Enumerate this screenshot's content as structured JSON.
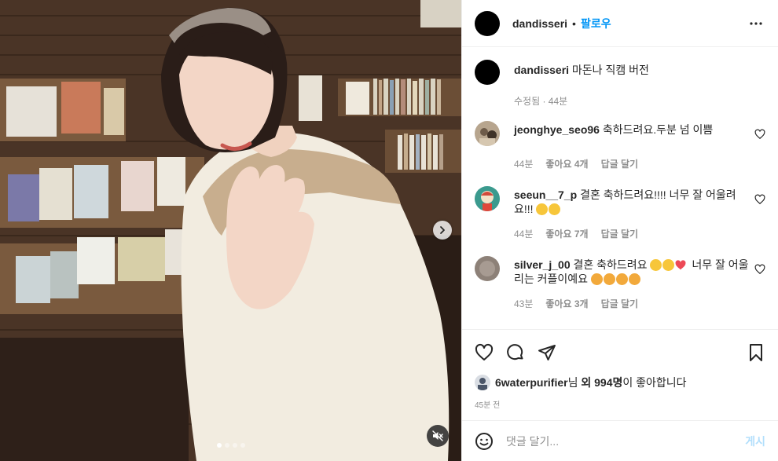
{
  "post": {
    "username": "dandisseri",
    "separator": "•",
    "follow_label": "팔로우"
  },
  "caption": {
    "username": "dandisseri",
    "text": "마돈나 직캠 버전",
    "meta": "수정됨 · 44분"
  },
  "comments": [
    {
      "username": "jeonghye_seo96",
      "text": "축하드려요.두분 넘 이쁨",
      "time": "44분",
      "likes": "좋아요 4개",
      "reply": "답글 달기"
    },
    {
      "username": "seeun__7_p",
      "text": "결혼 축하드려요!!!! 너무 잘 어울려요!!!",
      "time": "44분",
      "likes": "좋아요 7개",
      "reply": "답글 달기"
    },
    {
      "username": "silver_j_00",
      "text_a": "결혼 축하드려요",
      "text_b": "너무 잘 어울리는 커플이예요",
      "time": "43분",
      "likes": "좋아요 3개",
      "reply": "답글 달기"
    }
  ],
  "likes": {
    "user": "6waterpurifier",
    "suffix_1": "님 ",
    "others": "외 994명",
    "suffix_2": "이 좋아합니다"
  },
  "timestamp": "45분 전",
  "add_comment": {
    "placeholder": "댓글 달기...",
    "post_label": "게시"
  },
  "icons": {
    "more": "more-horizontal-icon",
    "like": "heart-icon",
    "comment": "comment-icon",
    "share": "share-icon",
    "save": "bookmark-icon",
    "emoji": "smiley-icon",
    "next": "chevron-right-icon",
    "mute": "muted-speaker-icon"
  },
  "colors": {
    "link_blue": "#0095f6",
    "post_disabled": "#b2dffc",
    "muted_text": "#8e8e8e",
    "heart_red": "#ed4956"
  },
  "carousel": {
    "total_slides": 4,
    "active_slide": 1
  }
}
